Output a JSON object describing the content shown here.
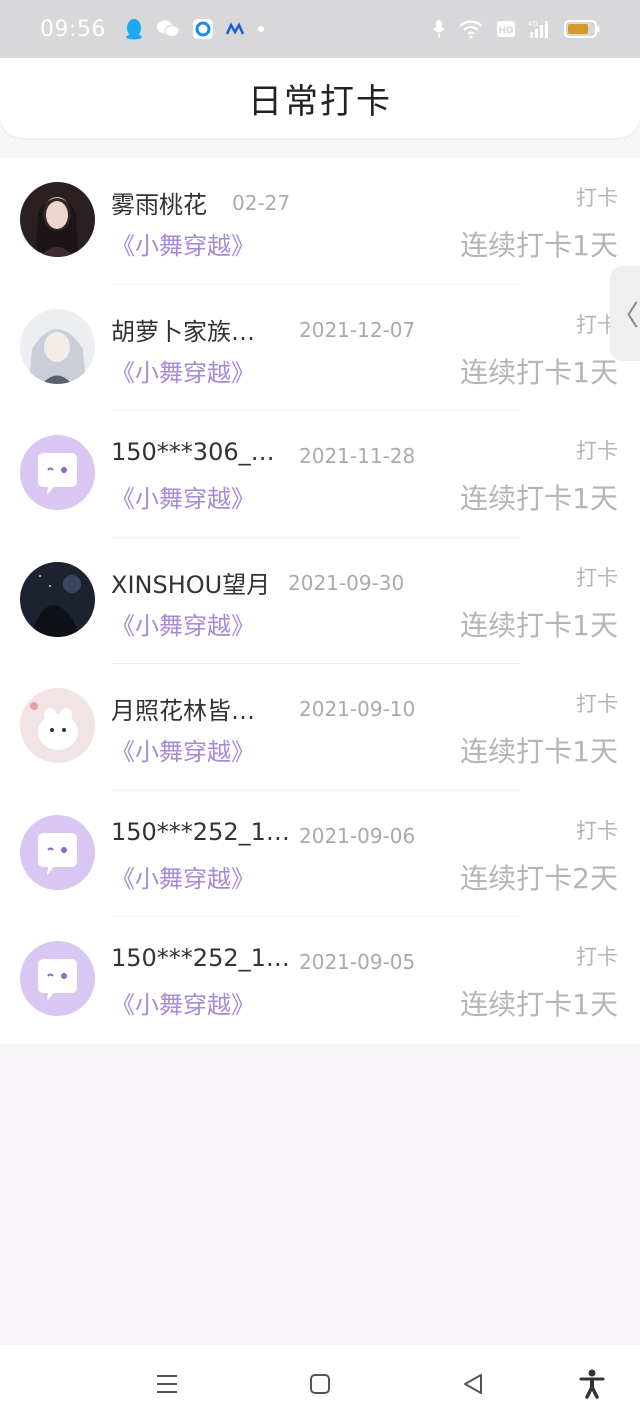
{
  "status_bar": {
    "time": "09:56",
    "icons_left": [
      "qq-icon",
      "wechat-icon",
      "browser-icon",
      "app-icon",
      "dot-icon"
    ],
    "icons_right": [
      "mic-icon",
      "wifi-icon",
      "hd-icon",
      "signal-4g-icon",
      "battery-icon"
    ]
  },
  "header": {
    "title": "日常打卡"
  },
  "entries": [
    {
      "name": "雾雨桃花",
      "date": "02-27",
      "course": "《小舞穿越》",
      "checkin_label": "打卡",
      "streak": "连续打卡1天",
      "avatar": "photo-girl"
    },
    {
      "name": "胡萝卜家族…",
      "date": "2021-12-07",
      "course": "《小舞穿越》",
      "checkin_label": "打卡",
      "streak": "连续打卡1天",
      "avatar": "anime-girl"
    },
    {
      "name": "150***306_…",
      "date": "2021-11-28",
      "course": "《小舞穿越》",
      "checkin_label": "打卡",
      "streak": "连续打卡1天",
      "avatar": "default-chat"
    },
    {
      "name": "XINSHOU望月",
      "date": "2021-09-30",
      "course": "《小舞穿越》",
      "checkin_label": "打卡",
      "streak": "连续打卡1天",
      "avatar": "night-scene"
    },
    {
      "name": "月照花林皆…",
      "date": "2021-09-10",
      "course": "《小舞穿越》",
      "checkin_label": "打卡",
      "streak": "连续打卡1天",
      "avatar": "white-bear"
    },
    {
      "name": "150***252_1…",
      "date": "2021-09-06",
      "course": "《小舞穿越》",
      "checkin_label": "打卡",
      "streak": "连续打卡2天",
      "avatar": "default-chat"
    },
    {
      "name": "150***252_1…",
      "date": "2021-09-05",
      "course": "《小舞穿越》",
      "checkin_label": "打卡",
      "streak": "连续打卡1天",
      "avatar": "default-chat"
    }
  ],
  "side_handle": {
    "glyph": "〈"
  },
  "nav_bar": {
    "buttons": [
      "menu-icon",
      "home-icon",
      "back-icon",
      "accessibility-icon"
    ]
  },
  "colors": {
    "accent": "#a98ad6",
    "avatar_bg": "#d9c6f2",
    "muted_text": "#b5b5b5"
  }
}
